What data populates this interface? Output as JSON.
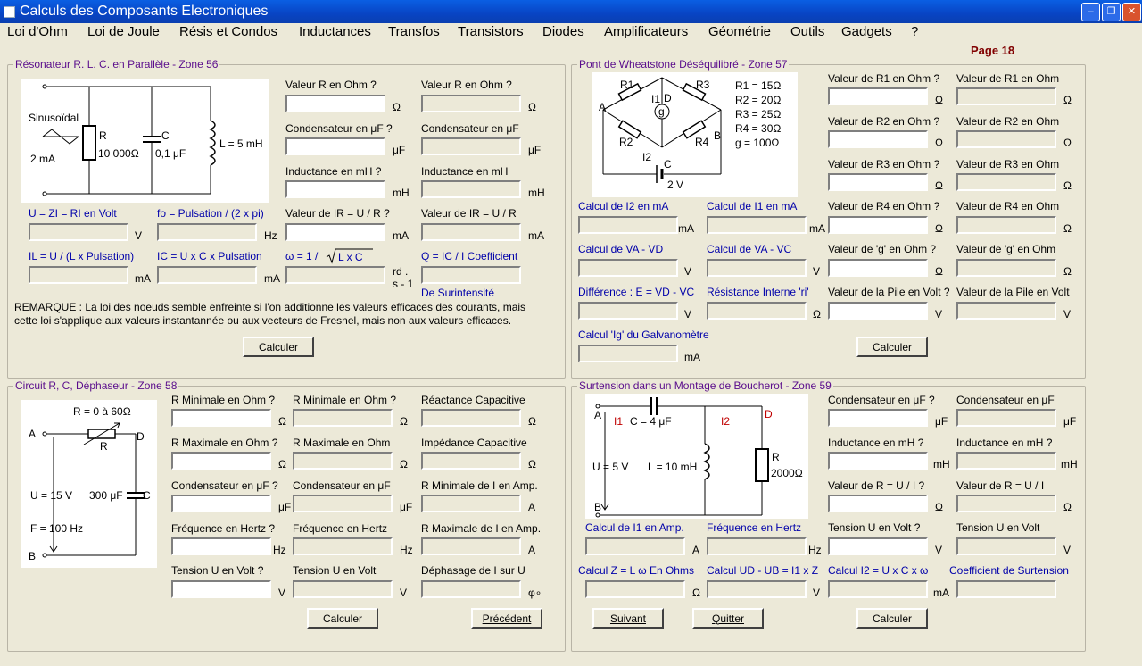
{
  "window": {
    "title": "Calculs des Composants Electroniques",
    "buttons": [
      "minimize-icon",
      "restore-icon",
      "close-icon"
    ]
  },
  "menu": [
    "Loi d'Ohm",
    "Loi de Joule",
    "Résis et Condos",
    "Inductances",
    "Transfos",
    "Transistors",
    "Diodes",
    "Amplificateurs",
    "Géométrie",
    "Outils",
    "Gadgets",
    "?"
  ],
  "page_label": "Page 18",
  "colors": {
    "group_title": "#5A0D8C",
    "page_label": "#800000",
    "background": "#ECE9D8",
    "formula_label": "#0000AA"
  },
  "zone56": {
    "title": "Résonateur R. L. C. en Parallèle - Zone 56",
    "diagram": {
      "source": "Sinusoïdal",
      "current": "2 mA",
      "r_name": "R",
      "r_value": "10 000Ω",
      "c_name": "C",
      "c_value": "0,1 μF",
      "l_value": "L = 5 mH"
    },
    "inputs": [
      {
        "label": "Valeur R en Ohm ?",
        "unit": "Ω"
      },
      {
        "label": "Condensateur en μF ?",
        "unit": "μF"
      },
      {
        "label": "Inductance en mH ?",
        "unit": "mH"
      },
      {
        "label": "Valeur de IR = U / R ?",
        "unit": "mA"
      }
    ],
    "outputs": [
      {
        "label": "Valeur R en Ohm ?",
        "unit": "Ω"
      },
      {
        "label": "Condensateur en μF",
        "unit": "μF"
      },
      {
        "label": "Inductance en mH",
        "unit": "mH"
      },
      {
        "label": "Valeur de IR = U / R",
        "unit": "mA"
      }
    ],
    "calc": [
      {
        "label": "U = ZI = RI en Volt",
        "unit": "V"
      },
      {
        "label": "fo = Pulsation / (2 x pi)",
        "unit": "Hz"
      },
      {
        "label": "IL = U / (L x Pulsation)",
        "unit": "mA"
      },
      {
        "label": "IC = U x C x Pulsation",
        "unit": "mA"
      }
    ],
    "omega_label": "ω = 1 /",
    "omega_sqrt": "L x C",
    "omega_unit": "rd . s - 1",
    "q_label": "Q = IC / I   Coefficient",
    "q_sub": "De Surintensité",
    "remark": "REMARQUE : La loi des noeuds semble enfreinte si l'on additionne les valeurs efficaces des courants, mais cette loi s'applique aux valeurs instantannée ou aux vecteurs de Fresnel, mais non aux valeurs efficaces.",
    "button": "Calculer"
  },
  "zone57": {
    "title": "Pont de Wheatstone Déséquilibré - Zone 57",
    "diagram": {
      "r1": "R1",
      "r2": "R2",
      "r3": "R3",
      "r4": "R4",
      "i1": "I1",
      "i2": "I2",
      "g": "g",
      "a": "A",
      "b": "B",
      "c": "C",
      "d": "D",
      "battery": "2 V",
      "values": [
        "R1 = 15Ω",
        "R2 = 20Ω",
        "R3 = 25Ω",
        "R4 = 30Ω",
        "g  = 100Ω"
      ]
    },
    "inputs": [
      {
        "label": "Valeur de R1 en Ohm ?",
        "unit": "Ω"
      },
      {
        "label": "Valeur de R2 en Ohm ?",
        "unit": "Ω"
      },
      {
        "label": "Valeur de R3 en Ohm ?",
        "unit": "Ω"
      },
      {
        "label": "Valeur de R4 en Ohm ?",
        "unit": "Ω"
      },
      {
        "label": "Valeur de 'g' en Ohm ?",
        "unit": "Ω"
      },
      {
        "label": "Valeur de la Pile en Volt ?",
        "unit": "V"
      }
    ],
    "outputs": [
      {
        "label": "Valeur de R1 en Ohm",
        "unit": "Ω"
      },
      {
        "label": "Valeur de R2 en Ohm",
        "unit": "Ω"
      },
      {
        "label": "Valeur de R3 en Ohm",
        "unit": "Ω"
      },
      {
        "label": "Valeur de R4 en Ohm",
        "unit": "Ω"
      },
      {
        "label": "Valeur de 'g' en Ohm",
        "unit": "Ω"
      },
      {
        "label": "Valeur de la Pile en Volt",
        "unit": "V"
      }
    ],
    "calc": [
      {
        "label": "Calcul de I2 en mA",
        "unit": "mA"
      },
      {
        "label": "Calcul de I1 en mA",
        "unit": "mA"
      },
      {
        "label": "Calcul de VA - VD",
        "unit": "V"
      },
      {
        "label": "Calcul de VA - VC",
        "unit": "V"
      },
      {
        "label": "Différence :  E = VD - VC",
        "unit": "V"
      },
      {
        "label": "Résistance Interne 'ri'",
        "unit": "Ω"
      },
      {
        "label": "Calcul 'Ig' du Galvanomètre",
        "unit": "mA"
      }
    ],
    "button": "Calculer"
  },
  "zone58": {
    "title": "Circuit R, C, Déphaseur - Zone 58",
    "diagram": {
      "r_range": "R = 0 à 60Ω",
      "a": "A",
      "b": "B",
      "d": "D",
      "r": "R",
      "c": "C",
      "u": "U = 15 V",
      "cap": "300 μF",
      "f": "F =  100 Hz"
    },
    "rows": [
      {
        "in": "R Minimale  en Ohm ?",
        "in_unit": "Ω",
        "out": "R Minimale  en Ohm ?",
        "out_unit": "Ω",
        "res": "Réactance Capacitive",
        "res_unit": "Ω"
      },
      {
        "in": "R Maximale en Ohm ?",
        "in_unit": "Ω",
        "out": "R Maximale en Ohm",
        "out_unit": "Ω",
        "res": "Impédance Capacitive",
        "res_unit": "Ω"
      },
      {
        "in": "Condensateur en μF ?",
        "in_unit": "μF",
        "out": "Condensateur en μF",
        "out_unit": "μF",
        "res": "R Minimale de I en Amp.",
        "res_unit": "A"
      },
      {
        "in": "Fréquence en Hertz ?",
        "in_unit": "Hz",
        "out": "Fréquence en Hertz",
        "out_unit": "Hz",
        "res": "R Maximale de I en Amp.",
        "res_unit": "A"
      },
      {
        "in": "Tension U en Volt ?",
        "in_unit": "V",
        "out": "Tension U en Volt",
        "out_unit": "V",
        "res": "Déphasage de I sur U",
        "res_unit": "φ∘"
      }
    ],
    "button": "Calculer",
    "prev_button": "Précédent"
  },
  "zone59": {
    "title": "Surtension dans un Montage de Boucherot - Zone 59",
    "diagram": {
      "a": "A",
      "b": "B",
      "d": "D",
      "i1": "I1",
      "i2": "I2",
      "cap": "C = 4 μF",
      "u": "U = 5 V",
      "l": "L = 10 mH",
      "r": "R",
      "r_value": "2000Ω"
    },
    "rows": [
      {
        "in": "Condensateur en μF ?",
        "in_unit": "μF",
        "out": "Condensateur en μF",
        "out_unit": "μF"
      },
      {
        "in": "Inductance en mH ?",
        "in_unit": "mH",
        "out": "Inductance en mH ?",
        "out_unit": "mH"
      },
      {
        "in": "Valeur de R = U / I ?",
        "in_unit": "Ω",
        "out": "Valeur de R = U / I",
        "out_unit": "Ω"
      },
      {
        "in": "Tension U en Volt ?",
        "in_unit": "V",
        "out": "Tension U en Volt",
        "out_unit": "V"
      }
    ],
    "calc": [
      {
        "label": "Calcul de I1 en Amp.",
        "unit": "A"
      },
      {
        "label": "Fréquence en Hertz",
        "unit": "Hz"
      },
      {
        "label": "Calcul Z = L ω En Ohms",
        "unit": "Ω"
      },
      {
        "label": "Calcul UD - UB = I1 x Z",
        "unit": "V"
      },
      {
        "label": "Calcul  I2 = U x C x ω",
        "unit": "mA"
      },
      {
        "label": "Coefficient de Surtension",
        "unit": ""
      }
    ],
    "next_button": "Suivant",
    "quit_button": "Quitter",
    "button": "Calculer"
  }
}
